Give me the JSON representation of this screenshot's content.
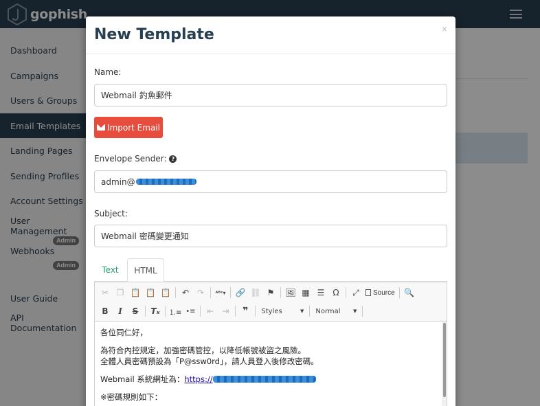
{
  "navbar": {
    "brand": "gophish"
  },
  "sidebar": {
    "items": [
      {
        "label": "Dashboard"
      },
      {
        "label": "Campaigns"
      },
      {
        "label": "Users & Groups"
      },
      {
        "label": "Email Templates"
      },
      {
        "label": "Landing Pages"
      },
      {
        "label": "Sending Profiles"
      },
      {
        "label": "Account Settings"
      },
      {
        "label": "User Management"
      },
      {
        "label": "Webhooks"
      },
      {
        "label": "User Guide"
      },
      {
        "label": "API Documentation"
      }
    ],
    "admin_badge": "Admin"
  },
  "modal": {
    "title": "New Template",
    "close": "×",
    "name_label": "Name:",
    "name_value": "Webmail 釣魚郵件",
    "import_button": "Import Email",
    "sender_label": "Envelope Sender:",
    "sender_value_prefix": "admin@",
    "subject_label": "Subject:",
    "subject_value": "Webmail 密碼變更通知",
    "tabs": {
      "text": "Text",
      "html": "HTML"
    },
    "toolbar": {
      "styles": "Styles",
      "format": "Normal",
      "source": "Source",
      "quote": "❞"
    },
    "body": {
      "greeting": "各位同仁好，",
      "line1": "為符合內控規定，加強密碼管控，以降低帳號被盜之風險。",
      "line2": "全體人員密碼預設為「P@ssw0rd」，請人員登入後修改密碼。",
      "line3_prefix": "Webmail 系統網址為：",
      "line3_link": "https://",
      "line4": "※密碼規則如下："
    }
  },
  "colors": {
    "navbar": "#283f50",
    "active": "#283f50",
    "import": "#e74c3c",
    "tab_active": "#2a9d6e"
  }
}
